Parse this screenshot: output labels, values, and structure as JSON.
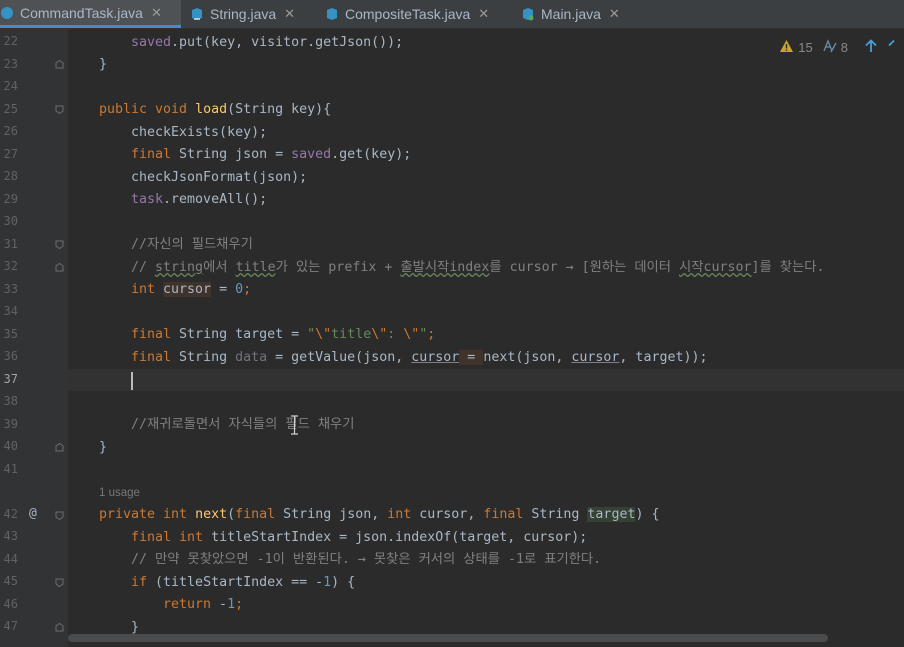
{
  "tabs": [
    {
      "label": "CommandTask.java",
      "close": "✕",
      "icon": "java-class-icon",
      "active": true
    },
    {
      "label": "String.java",
      "close": "✕",
      "icon": "java-class-icon",
      "active": false
    },
    {
      "label": "CompositeTask.java",
      "close": "✕",
      "icon": "java-class-icon",
      "active": false
    },
    {
      "label": "Main.java",
      "close": "✕",
      "icon": "java-class-icon",
      "active": false
    }
  ],
  "inspections": {
    "warnings": "15",
    "weak_warnings": "8"
  },
  "line_numbers": [
    "22",
    "23",
    "24",
    "25",
    "26",
    "27",
    "28",
    "29",
    "30",
    "31",
    "32",
    "33",
    "34",
    "35",
    "36",
    "37",
    "38",
    "39",
    "40",
    "41",
    "42",
    "43",
    "44",
    "45",
    "46",
    "47"
  ],
  "current_line": "37",
  "usage_hint": "1 usage",
  "code": {
    "l22": {
      "p1": "saved",
      "p2": ".put(key, visitor.getJson());"
    },
    "l23": "}",
    "l25": {
      "kw": "public void ",
      "name": "load",
      "rest": "(String key){"
    },
    "l26": "checkExists(key);",
    "l27": {
      "kw": "final ",
      "p1": "String json = ",
      "fld": "saved",
      "p2": ".get(key);"
    },
    "l28": "checkJsonFormat(json);",
    "l29": {
      "fld": "task",
      "p2": ".removeAll();"
    },
    "l31": "//자신의 필드채우기",
    "l32": {
      "a": "// ",
      "b": "string",
      "c": "에서 ",
      "d": "title",
      "e": "가 있는 prefix + ",
      "f": "출발시작index",
      "g": "를 cursor → [원하는 데이터 ",
      "h": "시작cursor",
      "i": "]를 찾는다."
    },
    "l33": {
      "kw": "int ",
      "var": "cursor",
      "eq": " = ",
      "num": "0",
      "semi": ";"
    },
    "l35": {
      "kw": "final ",
      "p1": "String target = ",
      "s1": "\"",
      "e1": "\\\"",
      "s2": "title",
      "e2": "\\\"",
      "s3": ": ",
      "e3": "\\\"",
      "s4": "\"",
      "semi": ";"
    },
    "l36": {
      "kw": "final ",
      "p1": "String ",
      "unused": "data",
      "p2": " = getValue(json, ",
      "c1": "cursor",
      "eq": " = ",
      "p3": "next(json, ",
      "c2": "cursor",
      "p4": ", target));"
    },
    "l39": "//재귀로돌면서 자식들의 필드 채우기",
    "l40": "}",
    "l42": {
      "kw1": "private int ",
      "name": "next",
      "p1": "(",
      "kw2": "final ",
      "p2": "String json, ",
      "kw3": "int ",
      "p3": "cursor, ",
      "kw4": "final ",
      "p4": "String ",
      "target": "target",
      "p5": ") {"
    },
    "l43": {
      "kw": "final int ",
      "p1": "titleStartIndex = json.indexOf(target, cursor);"
    },
    "l44": "// 만약 못찾았으면 -1이 반환된다. → 못찾은 커서의 상태를 -1로 표기한다.",
    "l45": {
      "kw": "if ",
      "p1": "(titleStartIndex == -",
      "num": "1",
      "p2": ") {"
    },
    "l46": {
      "kw": "return ",
      "p1": "-",
      "num": "1",
      "semi": ";"
    },
    "l47": "}"
  },
  "colors": {
    "keyword": "#cc7832",
    "field": "#9876aa",
    "method": "#ffc66d",
    "number": "#6897bb",
    "string": "#6a8759",
    "comment": "#808080",
    "text": "#a9b7c6",
    "warning": "#c9a42d",
    "accent": "#4a88c7"
  }
}
